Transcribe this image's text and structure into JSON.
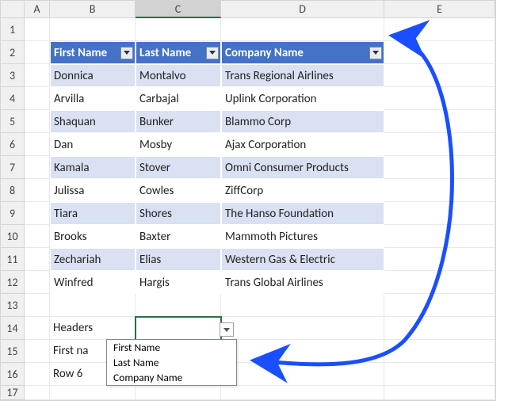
{
  "columns": {
    "A": "A",
    "B": "B",
    "C": "C",
    "D": "D",
    "E": "E"
  },
  "rows": [
    "1",
    "2",
    "3",
    "4",
    "5",
    "6",
    "7",
    "8",
    "9",
    "10",
    "11",
    "12",
    "13",
    "14",
    "15",
    "16",
    "17"
  ],
  "table": {
    "headers": [
      "First Name",
      "Last Name",
      "Company Name"
    ],
    "rows": [
      [
        "Donnica",
        "Montalvo",
        "Trans Regional Airlines"
      ],
      [
        "Arvilla",
        "Carbajal",
        "Uplink Corporation"
      ],
      [
        "Shaquan",
        "Bunker",
        "Blammo Corp"
      ],
      [
        "Dan",
        "Mosby",
        "Ajax Corporation"
      ],
      [
        "Kamala",
        "Stover",
        "Omni Consumer Products"
      ],
      [
        "Julissa",
        "Cowles",
        "ZiffCorp"
      ],
      [
        "Tiara",
        "Shores",
        "The Hanso Foundation"
      ],
      [
        "Brooks",
        "Baxter",
        "Mammoth Pictures"
      ],
      [
        "Zechariah",
        "Elias",
        "Western Gas & Electric"
      ],
      [
        "Winfred",
        "Hargis",
        "Trans Global Airlines"
      ]
    ]
  },
  "labels": {
    "headers": "Headers",
    "firstna": "First na",
    "row6": "Row 6"
  },
  "dropdown": {
    "options": [
      "First Name",
      "Last Name",
      "Company Name"
    ]
  },
  "selected_cell": "C14"
}
